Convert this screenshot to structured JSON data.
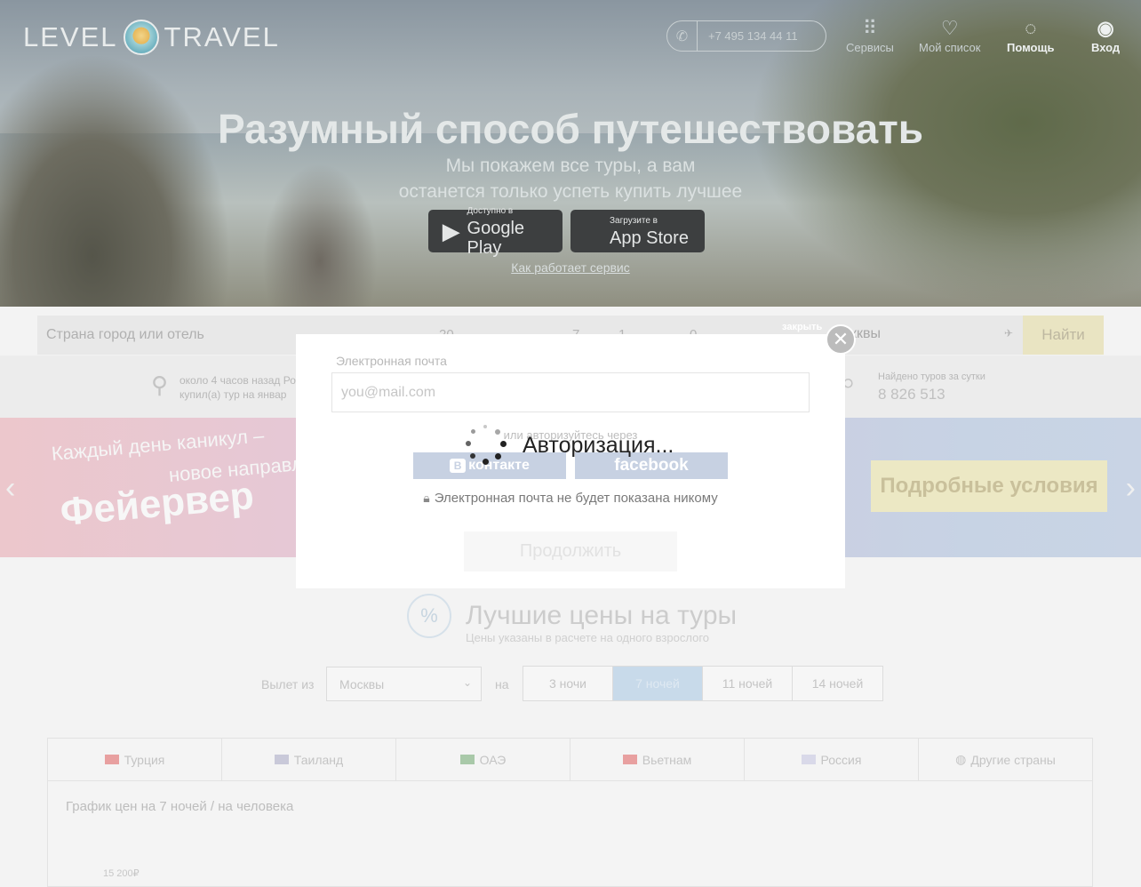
{
  "header": {
    "logo_left": "LEVEL",
    "logo_right": "TRAVEL",
    "phone": "+7 495 134 44 11",
    "nav": [
      {
        "label": "Сервисы",
        "icon": "grid-icon"
      },
      {
        "label": "Мой список",
        "icon": "heart-icon"
      },
      {
        "label": "Помощь",
        "icon": "help-bubble-icon"
      },
      {
        "label": "Вход",
        "icon": "user-icon"
      }
    ]
  },
  "hero": {
    "title": "Разумный способ путешествовать",
    "subtitle_line1": "Мы покажем все туры, а вам",
    "subtitle_line2": "останется только успеть купить лучшее",
    "google_small": "Доступно в",
    "google_big": "Google Play",
    "apple_small": "Загрузите в",
    "apple_big": "App Store",
    "how_link_prefix": "Как ",
    "how_link": "работает сервис"
  },
  "search": {
    "destination_placeholder": "Страна город или отель",
    "date": "20",
    "nights": "7",
    "adults": "1",
    "kids": "0",
    "from": "кквы",
    "find_label": "Найти"
  },
  "stats": {
    "recent_line1": "около 4 часов назад Ро",
    "recent_line2": "купил(а) тур на январ",
    "found_label": "Найдено туров за сутки",
    "found_value": "8 826 513"
  },
  "promo": {
    "line1": "Каждый день каникул –",
    "line2": "новое направле",
    "big": "Фейервер",
    "details_label": "Подробные условия"
  },
  "best_prices": {
    "title": "Лучшие цены на туры",
    "subtitle": "Цены указаны в расчете на одного взрослого",
    "depart_label": "Вылет из",
    "city": "Москвы",
    "na_label": "на",
    "nights": [
      "3 ночи",
      "7 ночей",
      "11 ночей",
      "14 ночей"
    ],
    "active_nights_index": 1,
    "countries": [
      {
        "label": "Турция",
        "flag": "#e8a0a0"
      },
      {
        "label": "Таиланд",
        "flag": "#c9c9d9"
      },
      {
        "label": "ОАЭ",
        "flag": "#a9c9a9"
      },
      {
        "label": "Вьетнам",
        "flag": "#e8a0a0"
      },
      {
        "label": "Россия",
        "flag": "#d9d9e9"
      },
      {
        "label": "Другие страны",
        "flag": ""
      }
    ],
    "chart_title": "График цен на 7 ночей / на человека",
    "chart_tick": "15 200₽"
  },
  "modal": {
    "email_label": "Электронная почта",
    "email_placeholder": "you@mail.com",
    "or_label": "или авторизуйтесь через",
    "vk_label": "контакте",
    "fb_label": "facebook",
    "privacy": "Электронная почта не будет показана никому",
    "continue_label": "Продолжить",
    "close_label": "закрыть",
    "loading_text": "Авторизация..."
  }
}
